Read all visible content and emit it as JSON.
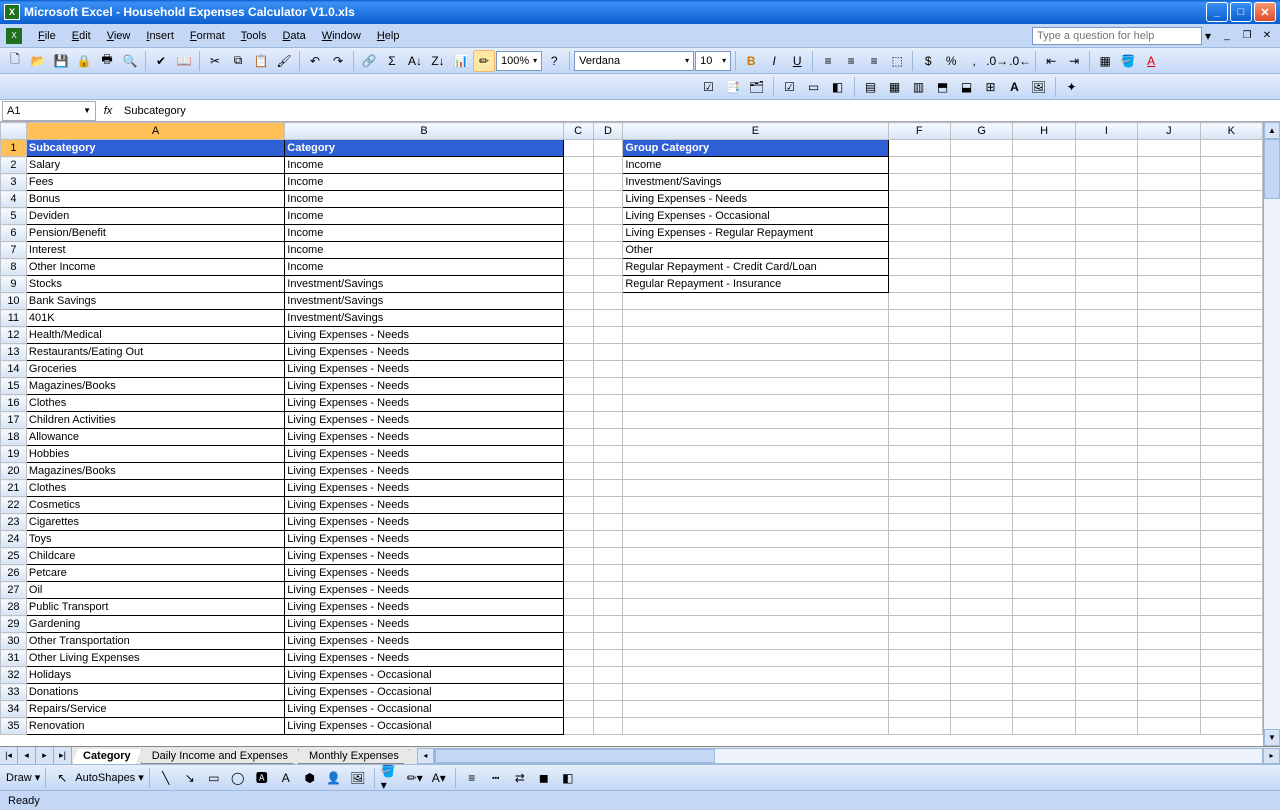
{
  "window": {
    "title": "Microsoft Excel - Household Expenses Calculator V1.0.xls",
    "app_letter": "X"
  },
  "menu": {
    "items": [
      "File",
      "Edit",
      "View",
      "Insert",
      "Format",
      "Tools",
      "Data",
      "Window",
      "Help"
    ],
    "help_placeholder": "Type a question for help"
  },
  "toolbar": {
    "zoom": "100%",
    "font": "Verdana",
    "size": "10"
  },
  "formula": {
    "cell_ref": "A1",
    "fx": "fx",
    "content": "Subcategory"
  },
  "columns": {
    "letters": [
      "A",
      "B",
      "C",
      "D",
      "E",
      "F",
      "G",
      "H",
      "I",
      "J",
      "K"
    ],
    "widths": [
      260,
      280,
      30,
      30,
      266,
      63,
      63,
      63,
      63,
      63,
      63
    ]
  },
  "sheet": {
    "headers": {
      "A": "Subcategory",
      "B": "Category",
      "E": "Group Category"
    },
    "rows": [
      {
        "n": 1
      },
      {
        "n": 2,
        "A": "Salary",
        "B": "Income",
        "E": "Income"
      },
      {
        "n": 3,
        "A": "Fees",
        "B": "Income",
        "E": "Investment/Savings"
      },
      {
        "n": 4,
        "A": "Bonus",
        "B": "Income",
        "E": "Living Expenses - Needs"
      },
      {
        "n": 5,
        "A": "Deviden",
        "B": "Income",
        "E": "Living Expenses - Occasional"
      },
      {
        "n": 6,
        "A": "Pension/Benefit",
        "B": "Income",
        "E": "Living Expenses - Regular Repayment"
      },
      {
        "n": 7,
        "A": "Interest",
        "B": "Income",
        "E": "Other"
      },
      {
        "n": 8,
        "A": "Other Income",
        "B": "Income",
        "E": "Regular Repayment - Credit Card/Loan"
      },
      {
        "n": 9,
        "A": "Stocks",
        "B": "Investment/Savings",
        "E": "Regular Repayment - Insurance"
      },
      {
        "n": 10,
        "A": "Bank Savings",
        "B": "Investment/Savings"
      },
      {
        "n": 11,
        "A": "401K",
        "B": "Investment/Savings"
      },
      {
        "n": 12,
        "A": "Health/Medical",
        "B": "Living Expenses - Needs"
      },
      {
        "n": 13,
        "A": "Restaurants/Eating Out",
        "B": "Living Expenses - Needs"
      },
      {
        "n": 14,
        "A": "Groceries",
        "B": "Living Expenses - Needs"
      },
      {
        "n": 15,
        "A": "Magazines/Books",
        "B": "Living Expenses - Needs"
      },
      {
        "n": 16,
        "A": "Clothes",
        "B": "Living Expenses - Needs"
      },
      {
        "n": 17,
        "A": "Children Activities",
        "B": "Living Expenses - Needs"
      },
      {
        "n": 18,
        "A": "Allowance",
        "B": "Living Expenses - Needs"
      },
      {
        "n": 19,
        "A": "Hobbies",
        "B": "Living Expenses - Needs"
      },
      {
        "n": 20,
        "A": "Magazines/Books",
        "B": "Living Expenses - Needs"
      },
      {
        "n": 21,
        "A": "Clothes",
        "B": "Living Expenses - Needs"
      },
      {
        "n": 22,
        "A": "Cosmetics",
        "B": "Living Expenses - Needs"
      },
      {
        "n": 23,
        "A": "Cigarettes",
        "B": "Living Expenses - Needs"
      },
      {
        "n": 24,
        "A": "Toys",
        "B": "Living Expenses - Needs"
      },
      {
        "n": 25,
        "A": "Childcare",
        "B": "Living Expenses - Needs"
      },
      {
        "n": 26,
        "A": "Petcare",
        "B": "Living Expenses - Needs"
      },
      {
        "n": 27,
        "A": "Oil",
        "B": "Living Expenses - Needs"
      },
      {
        "n": 28,
        "A": "Public Transport",
        "B": "Living Expenses - Needs"
      },
      {
        "n": 29,
        "A": "Gardening",
        "B": "Living Expenses - Needs"
      },
      {
        "n": 30,
        "A": "Other Transportation",
        "B": "Living Expenses - Needs"
      },
      {
        "n": 31,
        "A": "Other Living Expenses",
        "B": "Living Expenses - Needs"
      },
      {
        "n": 32,
        "A": "Holidays",
        "B": "Living Expenses - Occasional"
      },
      {
        "n": 33,
        "A": "Donations",
        "B": "Living Expenses - Occasional"
      },
      {
        "n": 34,
        "A": "Repairs/Service",
        "B": "Living Expenses - Occasional"
      },
      {
        "n": 35,
        "A": "Renovation",
        "B": "Living Expenses - Occasional"
      }
    ]
  },
  "tabs": {
    "sheets": [
      "Category",
      "Daily Income and Expenses",
      "Monthly Expenses"
    ],
    "active": 0
  },
  "drawbar": {
    "draw": "Draw",
    "autoshapes": "AutoShapes"
  },
  "status": {
    "text": "Ready"
  }
}
